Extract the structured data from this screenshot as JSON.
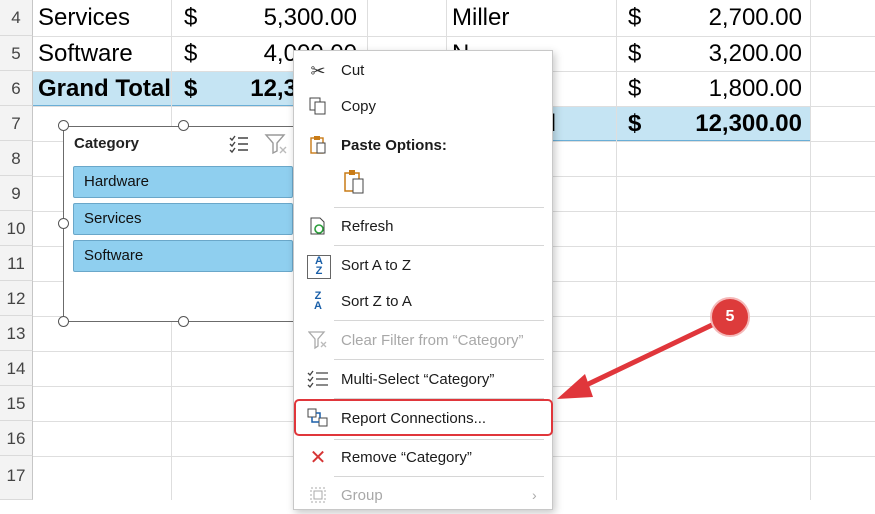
{
  "rows": [
    "4",
    "5",
    "6",
    "7",
    "8",
    "9",
    "10",
    "11",
    "12",
    "13",
    "14",
    "15",
    "16",
    "17"
  ],
  "left_table": [
    {
      "label": "Services",
      "currency": "$",
      "value": "5,300.00"
    },
    {
      "label": "Software",
      "currency": "$",
      "value": "4,000.00"
    },
    {
      "label": "Grand Total",
      "currency": "$",
      "value": "12,300.00"
    }
  ],
  "right_table": [
    {
      "label": "Miller",
      "currency": "$",
      "value": "2,700.00"
    },
    {
      "label": "N",
      "currency": "$",
      "value": "3,200.00"
    },
    {
      "label": "",
      "currency": "$",
      "value": "1,800.00"
    },
    {
      "label": "tal",
      "currency": "$",
      "value": "12,300.00"
    }
  ],
  "slicer": {
    "title": "Category",
    "items": [
      "Hardware",
      "Services",
      "Software"
    ]
  },
  "menu": {
    "cut": "Cut",
    "copy": "Copy",
    "paste_options": "Paste Options:",
    "refresh": "Refresh",
    "sort_az": "Sort A to Z",
    "sort_za": "Sort Z to A",
    "clear_filter": "Clear Filter from “Category”",
    "multi_select": "Multi-Select “Category”",
    "report_connections": "Report Connections...",
    "remove": "Remove “Category”",
    "group": "Group"
  },
  "annotation": {
    "step": "5"
  },
  "colors": {
    "highlight": "#e0363b",
    "slicer_item": "#8fcfef",
    "total_row": "#c5e4f3"
  }
}
